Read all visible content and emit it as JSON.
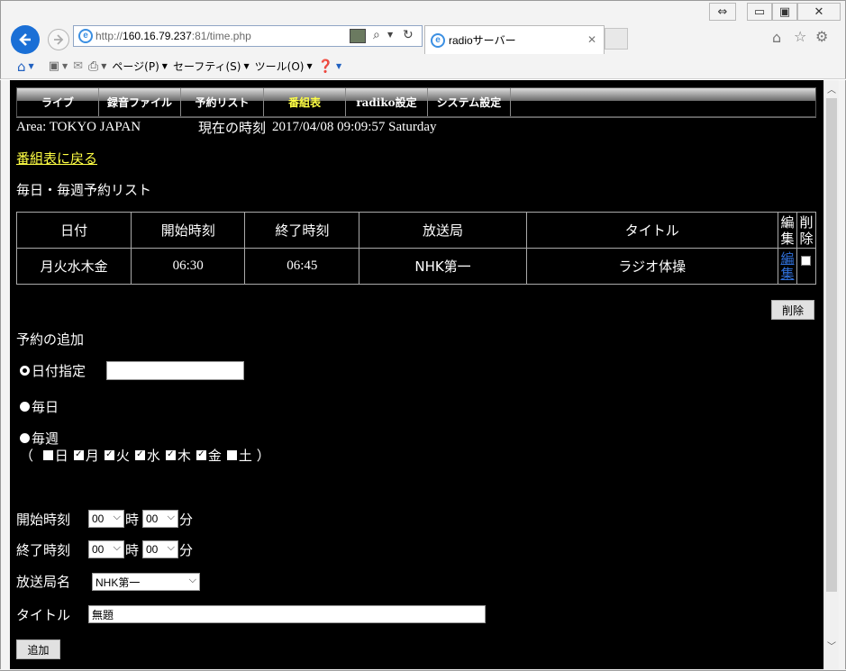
{
  "browser": {
    "url_prefix": "http://",
    "url_host": "160.16.79.237",
    "url_rest": ":81/time.php",
    "tab_title": "radioサーバー",
    "commands": [
      "ページ(P)",
      "セーフティ(S)",
      "ツール(O)"
    ]
  },
  "nav": {
    "items": [
      "ライブ",
      "録音ファイル",
      "予約リスト",
      "番組表",
      "radiko設定",
      "システム設定"
    ],
    "active_index": 3
  },
  "info": {
    "area": "Area: TOKYO JAPAN",
    "clock_label": "現在の時刻",
    "clock_value": "2017/04/08 09:09:57 Saturday"
  },
  "back_link": "番組表に戻る",
  "list_heading": "毎日・毎週予約リスト",
  "table": {
    "headers": [
      "日付",
      "開始時刻",
      "終了時刻",
      "放送局",
      "タイトル",
      "編集",
      "削除"
    ],
    "rows": [
      {
        "days": "月火水木金",
        "start": "06:30",
        "end": "06:45",
        "station": "NHK第一",
        "title": "ラジオ体操",
        "edit": "編集"
      }
    ]
  },
  "delete_button": "削除",
  "add": {
    "heading": "予約の追加",
    "option_date": "日付指定",
    "option_daily": "毎日",
    "option_weekly": "毎週",
    "weekdays": [
      {
        "label": "日",
        "checked": false
      },
      {
        "label": "月",
        "checked": true
      },
      {
        "label": "火",
        "checked": true
      },
      {
        "label": "水",
        "checked": true
      },
      {
        "label": "木",
        "checked": true
      },
      {
        "label": "金",
        "checked": true
      },
      {
        "label": "土",
        "checked": false
      }
    ],
    "paren_open": "（",
    "paren_close": "）",
    "start_label": "開始時刻",
    "end_label": "終了時刻",
    "hour_unit": "時",
    "min_unit": "分",
    "start_hour": "00",
    "start_min": "00",
    "end_hour": "00",
    "end_min": "00",
    "station_label": "放送局名",
    "station_value": "NHK第一",
    "title_label": "タイトル",
    "title_value": "無題",
    "submit": "追加"
  }
}
